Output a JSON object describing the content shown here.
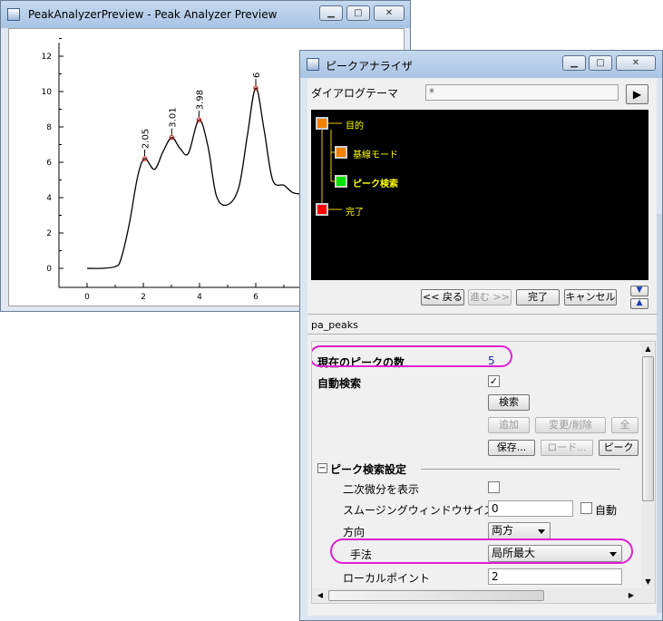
{
  "graph_window": {
    "title": "PeakAnalyzerPreview - Peak Analyzer Preview",
    "y_ticks": [
      "12",
      "10",
      "8",
      "6",
      "4",
      "2",
      "0"
    ],
    "x_ticks": [
      "0",
      "2",
      "4",
      "6"
    ],
    "peak_labels": [
      "2.05",
      "3.01",
      "3.98",
      "6"
    ],
    "curve_color": "#000000",
    "marker_color": "#cc0000"
  },
  "chart_data": {
    "type": "line",
    "x": [
      0,
      0.5,
      1.0,
      1.2,
      1.5,
      1.8,
      2.05,
      2.4,
      2.7,
      3.01,
      3.3,
      3.6,
      3.98,
      4.3,
      4.6,
      5.0,
      5.4,
      5.7,
      6.0,
      6.3,
      6.6,
      7.0,
      7.3,
      7.6
    ],
    "y": [
      0,
      0,
      0.1,
      0.5,
      2.5,
      5.2,
      6.2,
      5.6,
      6.6,
      7.4,
      6.8,
      6.5,
      8.4,
      6.9,
      4.1,
      3.6,
      4.6,
      7.5,
      10.2,
      7.8,
      5.0,
      4.7,
      4.3,
      4.2
    ],
    "peaks": [
      {
        "x": 2.05,
        "y": 6.2
      },
      {
        "x": 3.01,
        "y": 7.4
      },
      {
        "x": 3.98,
        "y": 8.4
      },
      {
        "x": 6.0,
        "y": 10.2
      }
    ],
    "xlim": [
      -1,
      8
    ],
    "ylim": [
      -1,
      12
    ]
  },
  "dialog": {
    "title": "ピークアナライザ",
    "theme_label": "ダイアログテーマ",
    "theme_value": "*",
    "tree": [
      {
        "label": "目的",
        "color": "#f08000"
      },
      {
        "label": "基線モード",
        "color": "#f08000"
      },
      {
        "label": "ピーク検索",
        "color": "#00e000"
      },
      {
        "label": "完了",
        "color": "#ff0000"
      }
    ],
    "nav": {
      "back": "<< 戻る",
      "next": "進む >>",
      "finish": "完了",
      "cancel": "キャンセル"
    },
    "page_name": "pa_peaks",
    "props": {
      "peak_count_label": "現在のピークの数",
      "peak_count_value": "5",
      "auto_find_label": "自動検索",
      "auto_find_check": "✓",
      "find_button": "検索",
      "add_button": "追加",
      "modify_button": "変更/削除",
      "all_button": "全",
      "save_button": "保存...",
      "load_button": "ロード...",
      "peak_button": "ピーク",
      "section_label": "ピーク検索設定",
      "section_toggle": "−",
      "show_2nd_deriv_label": "二次微分を表示",
      "smooth_window_label": "スムージングウィンドウサイズ",
      "smooth_window_value": "0",
      "auto_label": "自動",
      "direction_label": "方向",
      "direction_value": "両方",
      "method_label": "手法",
      "method_value": "局所最大",
      "local_points_label": "ローカルポイント",
      "local_points_value": "2"
    },
    "highlight_color": "#e01fd0"
  }
}
